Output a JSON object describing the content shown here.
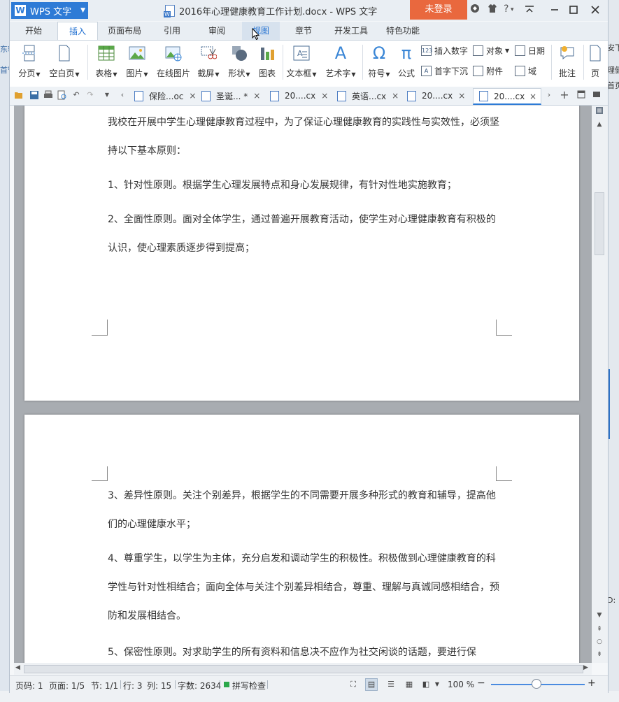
{
  "background": {
    "left_fragments": [
      "东辑",
      "首管"
    ],
    "right_fragments": [
      "安下",
      "理健",
      "首页",
      "D:"
    ]
  },
  "titlebar": {
    "app_name": "WPS 文字",
    "app_logo": "W",
    "doc_title": "2016年心理健康教育工作计划.docx - WPS 文字",
    "login_label": "未登录",
    "help_label": "?"
  },
  "ribbon_tabs": [
    "开始",
    "插入",
    "页面布局",
    "引用",
    "审阅",
    "视图",
    "章节",
    "开发工具",
    "特色功能"
  ],
  "ribbon": {
    "big_buttons": [
      {
        "label": "分页",
        "icon": "page-break-icon",
        "has_dropdown": true
      },
      {
        "label": "空白页",
        "icon": "blank-page-icon",
        "has_dropdown": true
      },
      {
        "label": "表格",
        "icon": "table-icon",
        "has_dropdown": true
      },
      {
        "label": "图片",
        "icon": "picture-icon",
        "has_dropdown": true
      },
      {
        "label": "在线图片",
        "icon": "online-picture-icon",
        "has_dropdown": false
      },
      {
        "label": "截屏",
        "icon": "screenshot-icon",
        "has_dropdown": true
      },
      {
        "label": "形状",
        "icon": "shapes-icon",
        "has_dropdown": true
      },
      {
        "label": "图表",
        "icon": "chart-icon",
        "has_dropdown": false
      },
      {
        "label": "文本框",
        "icon": "textbox-icon",
        "has_dropdown": true
      },
      {
        "label": "艺术字",
        "icon": "wordart-icon",
        "has_dropdown": true
      },
      {
        "label": "符号",
        "icon": "symbol-icon",
        "has_dropdown": true
      },
      {
        "label": "公式",
        "icon": "formula-icon",
        "has_dropdown": false
      },
      {
        "label": "批注",
        "icon": "comment-icon",
        "has_dropdown": false
      },
      {
        "label": "页",
        "icon": "page-icon",
        "has_dropdown": false
      }
    ],
    "small_buttons": [
      {
        "label": "插入数字",
        "icon": "number-icon"
      },
      {
        "label": "首字下沉",
        "icon": "drop-cap-icon"
      },
      {
        "label": "对象",
        "icon": "object-icon"
      },
      {
        "label": "附件",
        "icon": "attachment-icon"
      },
      {
        "label": "日期",
        "icon": "date-icon"
      },
      {
        "label": "域",
        "icon": "field-icon"
      }
    ],
    "glyphs": {
      "symbol": "Ω",
      "formula": "π",
      "wordart": "A",
      "number": "123"
    }
  },
  "doc_tabs": [
    "保险...oc",
    "圣诞... *",
    "20....cx",
    "英语...cx",
    "20....cx",
    "20....cx"
  ],
  "document": {
    "page1_paragraphs": [
      "我校在开展中学生心理健康教育过程中，为了保证心理健康教育的实践性与实效性，必须坚持以下基本原则：",
      "1、针对性原则。根据学生心理发展特点和身心发展规律，有针对性地实施教育；",
      "2、全面性原则。面对全体学生，通过普遍开展教育活动，使学生对心理健康教育有积极的认识，使心理素质逐步得到提高；"
    ],
    "page2_paragraphs": [
      "3、差异性原则。关注个别差异，根据学生的不同需要开展多种形式的教育和辅导，提高他们的心理健康水平；",
      "4、尊重学生，以学生为主体，充分启发和调动学生的积极性。积极做到心理健康教育的科学性与针对性相结合；面向全体与关注个别差异相结合，尊重、理解与真诚同感相结合，预防和发展相结合。",
      "5、保密性原则。对求助学生的所有资料和信息决不应作为社交闲谈的话题，要进行保"
    ]
  },
  "statusbar": {
    "page_num": "页码: 1",
    "page_of": "页面: 1/5",
    "section": "节: 1/1",
    "row": "行: 3",
    "col": "列: 15",
    "word_count": "字数: 2634",
    "spell_check": "拼写检查",
    "zoom_level": "100 %",
    "zoom_fraction": 0.5
  },
  "colors": {
    "accent": "#2e7bd6",
    "login": "#e9683e",
    "active_tab_text": "#1f6fd1",
    "spell_ok": "#2aa84a"
  }
}
